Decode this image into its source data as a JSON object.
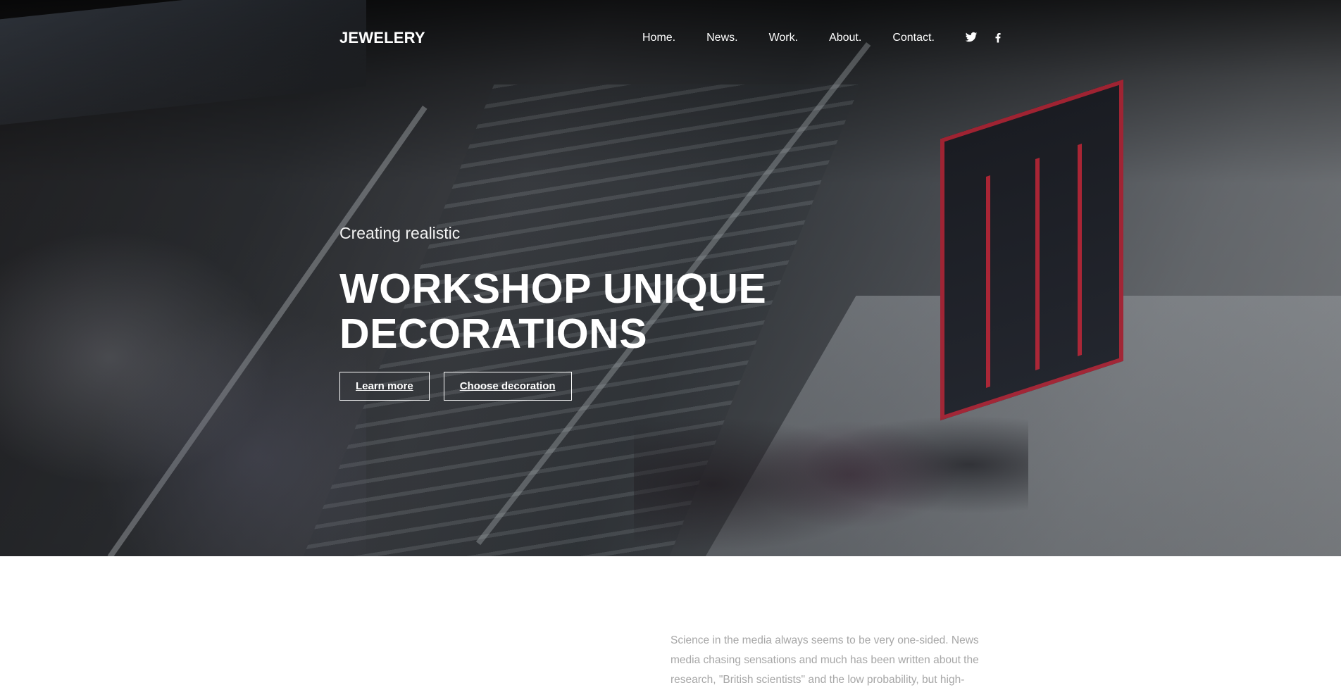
{
  "header": {
    "brand": "JEWELERY",
    "nav": [
      {
        "label": "Home."
      },
      {
        "label": "News."
      },
      {
        "label": "Work."
      },
      {
        "label": "About."
      },
      {
        "label": "Contact."
      }
    ],
    "social": [
      {
        "icon": "twitter-icon"
      },
      {
        "icon": "facebook-icon"
      }
    ]
  },
  "hero": {
    "subtitle": "Creating realistic",
    "headline_line1": "WORKSHOP UNIQUE",
    "headline_line2": "DECORATIONS",
    "buttons": [
      {
        "label": "Learn more"
      },
      {
        "label": "Choose decoration"
      }
    ]
  },
  "intro": {
    "text": "Science in the media always seems to be very one-sided. News media chasing sensations and much has been written about the research, \"British scientists\" and the low probability, but high-"
  },
  "colors": {
    "text_on_dark": "#ffffff",
    "muted_text": "#a6a6a6",
    "accent_red": "#e6283c"
  }
}
